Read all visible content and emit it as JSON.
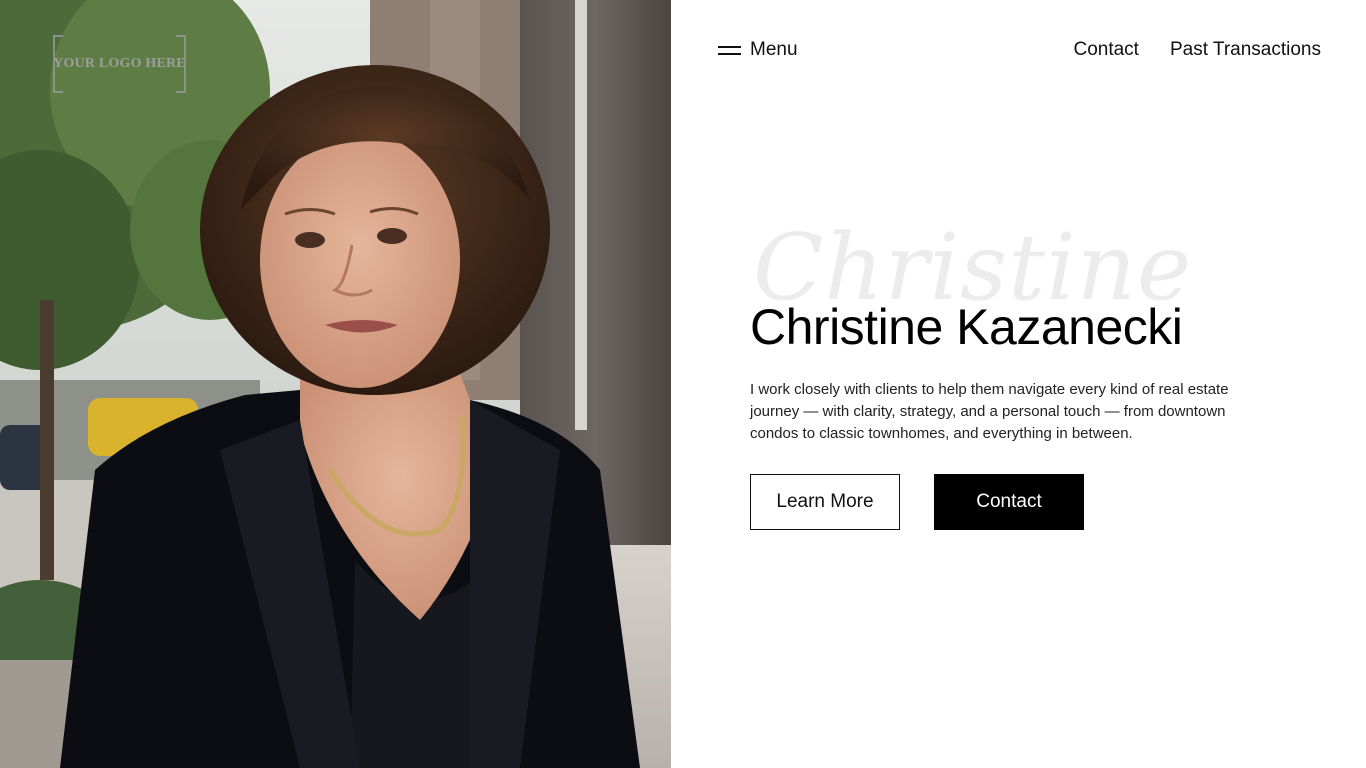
{
  "brand": {
    "logo_text": "YOUR LOGO HERE"
  },
  "header": {
    "menu_label": "Menu",
    "nav": [
      {
        "label": "Contact"
      },
      {
        "label": "Past Transactions"
      }
    ]
  },
  "hero": {
    "script_text": "Christine",
    "name": "Christine Kazanecki",
    "description": "I work closely with clients to help them navigate every kind of real estate journey — with clarity, strategy, and a personal touch — from downtown condos to classic townhomes, and everything in between.",
    "learn_more_label": "Learn More",
    "contact_label": "Contact"
  },
  "colors": {
    "background": "#ffffff",
    "text": "#111111",
    "primary_button_bg": "#000000",
    "primary_button_text": "#ffffff"
  }
}
